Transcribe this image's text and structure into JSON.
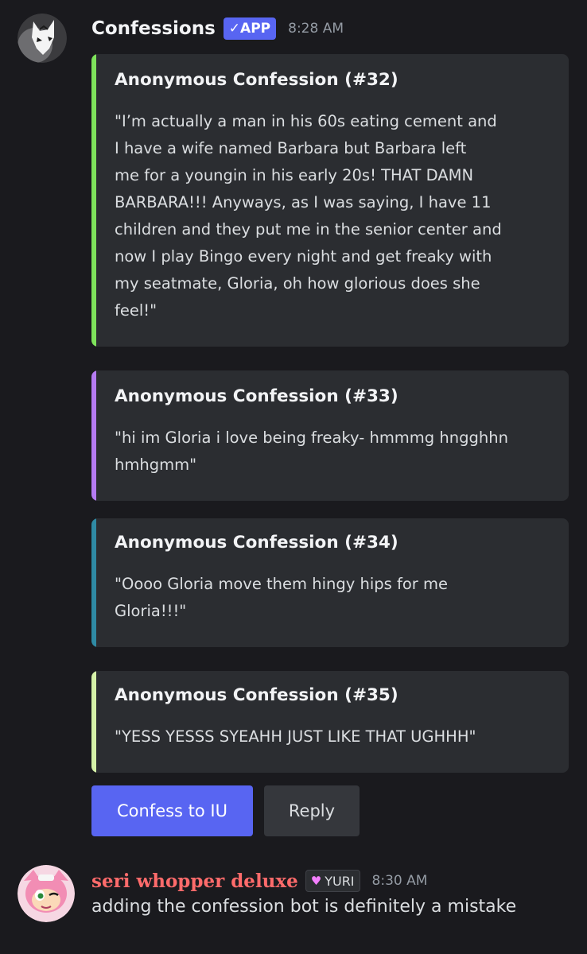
{
  "bot_message": {
    "author": "Confessions",
    "badge": "✓APP",
    "time": "8:28 AM",
    "embeds": [
      {
        "title": "Anonymous Confession (#32)",
        "lines": [
          "\"I’m actually a man in his 60s eating cement and",
          "I have a wife named Barbara but Barbara left",
          "me for a youngin in his early 20s! THAT DAMN",
          "BARBARA!!! Anyways, as I was saying, I have 11",
          "children and they put me in the senior center and",
          "now I play Bingo every night and get freaky with",
          "my seatmate, Gloria, oh how glorious does she",
          "feel!\""
        ],
        "color": "#7ee35b"
      },
      {
        "title": "Anonymous Confession (#33)",
        "lines": [
          "\"hi im Gloria i love being freaky- hmmmg hngghhn",
          "hmhgmm\""
        ],
        "color": "#b57bf2"
      },
      {
        "title": "Anonymous Confession (#34)",
        "lines": [
          "\"Oooo Gloria move them hingy hips for me",
          "Gloria!!!\""
        ],
        "color": "#2f8aa4"
      },
      {
        "title": "Anonymous Confession (#35)",
        "lines": [
          "\"YESS YESSS SYEAHH JUST LIKE THAT UGHHH\""
        ],
        "color": "#d5f1a8"
      }
    ],
    "buttons": {
      "confess": "Confess to IU",
      "reply": "Reply"
    }
  },
  "user_message": {
    "author": "seri whopper deluxe",
    "role_tag": "YURI",
    "time": "8:30 AM",
    "text": "adding the confession bot is definitely a mistake"
  }
}
